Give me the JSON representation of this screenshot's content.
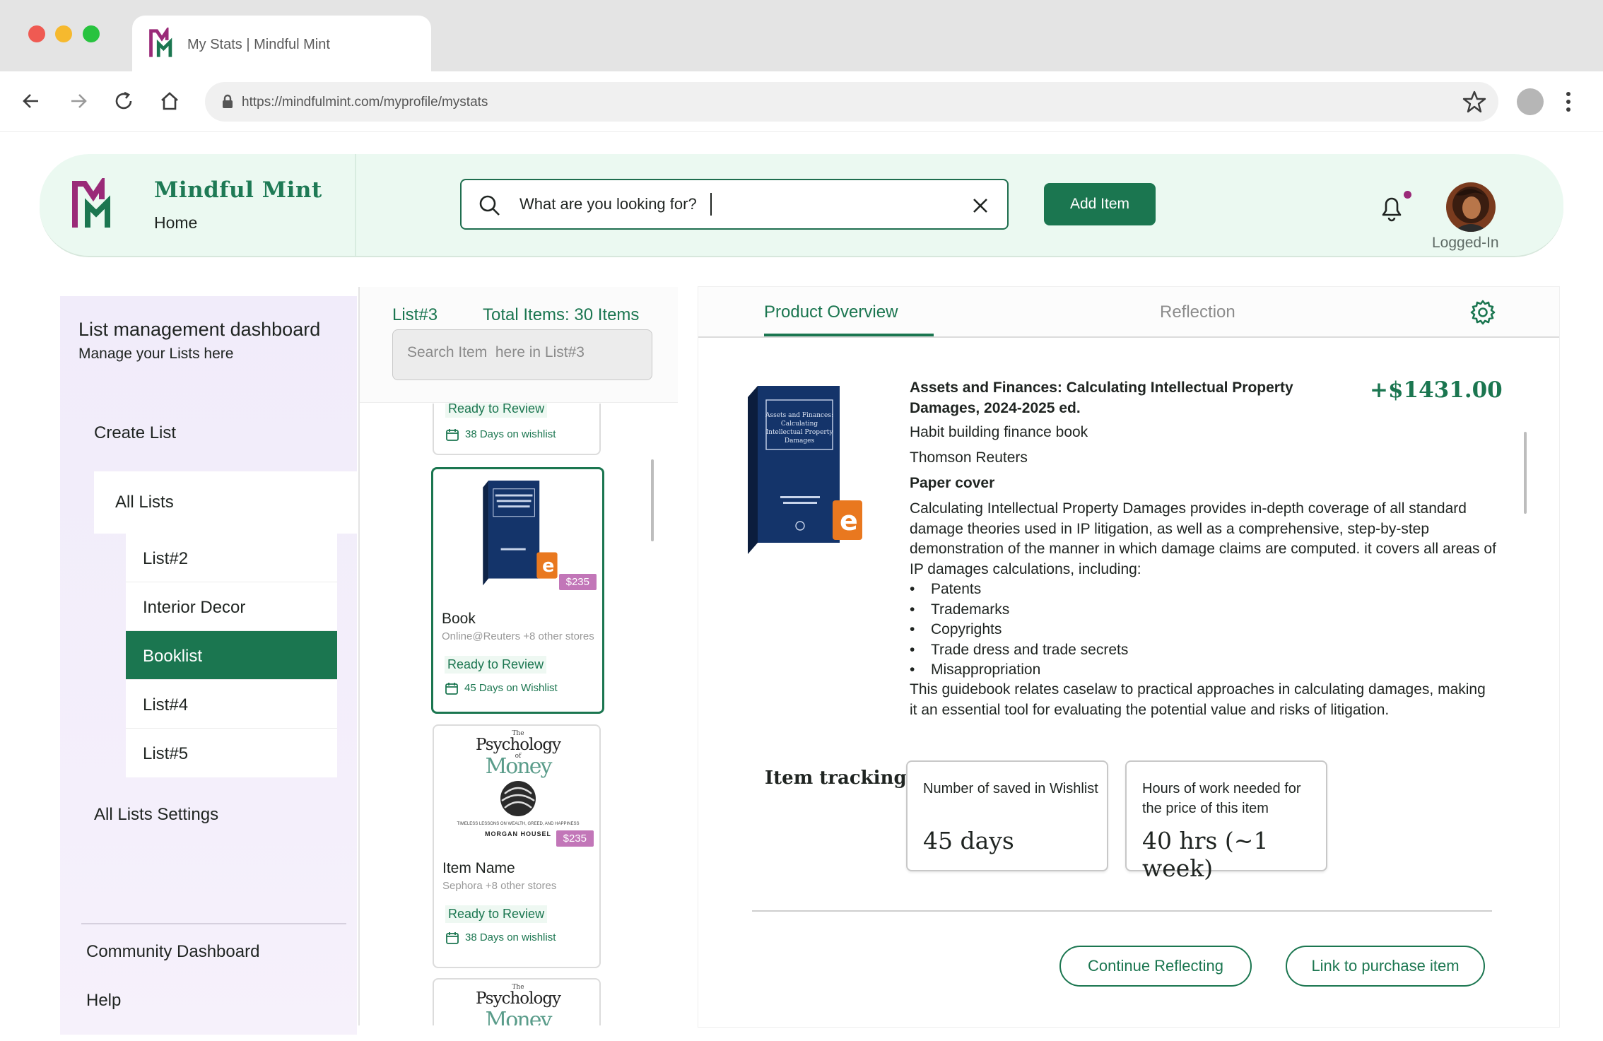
{
  "browser": {
    "tab_title": "My Stats | Mindful Mint",
    "url": "https://mindfulmint.com/myprofile/mystats",
    "icons": [
      "back-arrow-icon",
      "forward-arrow-icon",
      "reload-icon",
      "home-icon",
      "lock-icon",
      "star-icon",
      "kebab-menu-icon"
    ]
  },
  "colors": {
    "brand_green": "#1b7650",
    "brand_purple": "#9a2a78",
    "header_bg": "#ebf9f1",
    "sidebar_bg": "#f1ecfa",
    "price_badge": "#c276b8"
  },
  "header": {
    "brand": "Mindful Mint",
    "subtitle": "Home",
    "search_placeholder": "What are you looking for?",
    "add_button": "Add Item",
    "user_label": "Logged-In"
  },
  "sidebar": {
    "title": "List management dashboard",
    "subtitle": "Manage your Lists here",
    "create": "Create List",
    "all_lists": "All Lists",
    "lists": [
      {
        "label": "List#2",
        "active": false
      },
      {
        "label": "Interior Decor",
        "active": false
      },
      {
        "label": "Booklist",
        "active": true
      },
      {
        "label": "List#4",
        "active": false
      },
      {
        "label": "List#5",
        "active": false
      }
    ],
    "settings": "All Lists Settings",
    "community": "Community Dashboard",
    "help": "Help"
  },
  "list_panel": {
    "list_name": "List#3",
    "total": "Total Items: 30 Items",
    "search_placeholder": "Search Item  here in List#3",
    "cards": [
      {
        "name": "",
        "store": "",
        "status": "Ready to Review",
        "days": "38 Days on wishlist",
        "price": ""
      },
      {
        "name": "Book",
        "store": "Online@Reuters +8 other stores",
        "status": "Ready to Review",
        "days": "45 Days on Wishlist",
        "price": "$235"
      },
      {
        "name": "Item Name",
        "store": "Sephora  +8 other stores",
        "status": "Ready to Review",
        "days": "38 Days on wishlist",
        "price": "$235"
      },
      {
        "name": "",
        "store": "",
        "status": "",
        "days": "",
        "price": ""
      }
    ],
    "book_cover": {
      "label": "Assets and Finances: Calculating Intellectual Property Damages"
    },
    "psych_cover": {
      "kicker": "The",
      "title_a": "Psychology",
      "of": "of",
      "title_b": "Money",
      "tagline": "TIMELESS LESSONS ON WEALTH, GREED, AND HAPPINESS",
      "author": "MORGAN HOUSEL"
    }
  },
  "detail": {
    "tabs": [
      "Product  Overview",
      "Reflection"
    ],
    "title": "Assets and Finances: Calculating Intellectual Property Damages, 2024-2025 ed.",
    "price": "+$1431.00",
    "category": "Habit building finance book",
    "publisher": "Thomson Reuters",
    "format": "Paper cover",
    "description": "Calculating Intellectual Property Damages provides in-depth coverage of all standard damage theories used in IP litigation, as well as a comprehensive, step-by-step demonstration of the manner in which damage claims are computed.  it covers all areas of IP damages calculations, including:",
    "bullets": [
      "Patents",
      "Trademarks",
      "Copyrights",
      "Trade dress and trade secrets",
      "Misappropriation"
    ],
    "closing": "This guidebook relates caselaw to practical approaches in calculating damages, making it an essential tool for evaluating the potential value and risks of litigation.",
    "tracking": {
      "label": "Item tracking",
      "saved_label": "Number of saved in Wishlist",
      "saved_value": "45 days",
      "hours_label": "Hours of work needed for the price of this item",
      "hours_value": "40 hrs (~1 week)"
    },
    "continue_button": "Continue Reflecting",
    "link_button": "Link to purchase item"
  }
}
